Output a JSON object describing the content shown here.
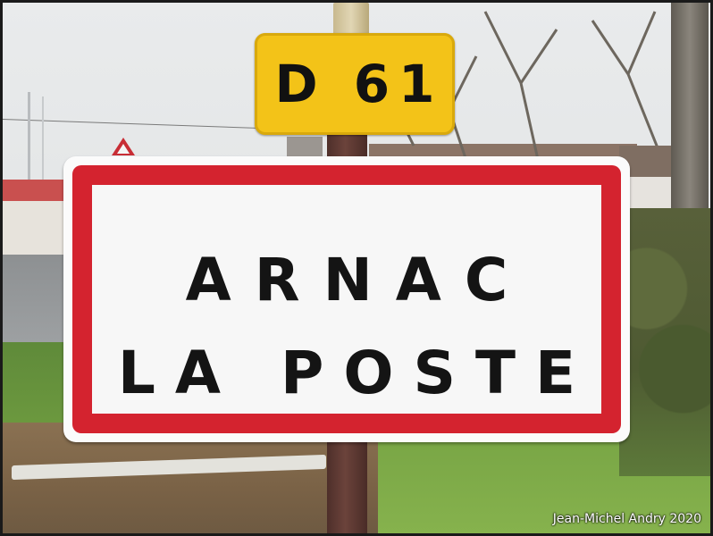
{
  "route_plate": {
    "text": "D 61",
    "color": "#f3c318"
  },
  "town_sign": {
    "line1": "ARNAC",
    "line2": "LA POSTE",
    "border_color": "#d4232f",
    "background": "#f7f7f7"
  },
  "watermark": "Jean-Michel Andry 2020"
}
